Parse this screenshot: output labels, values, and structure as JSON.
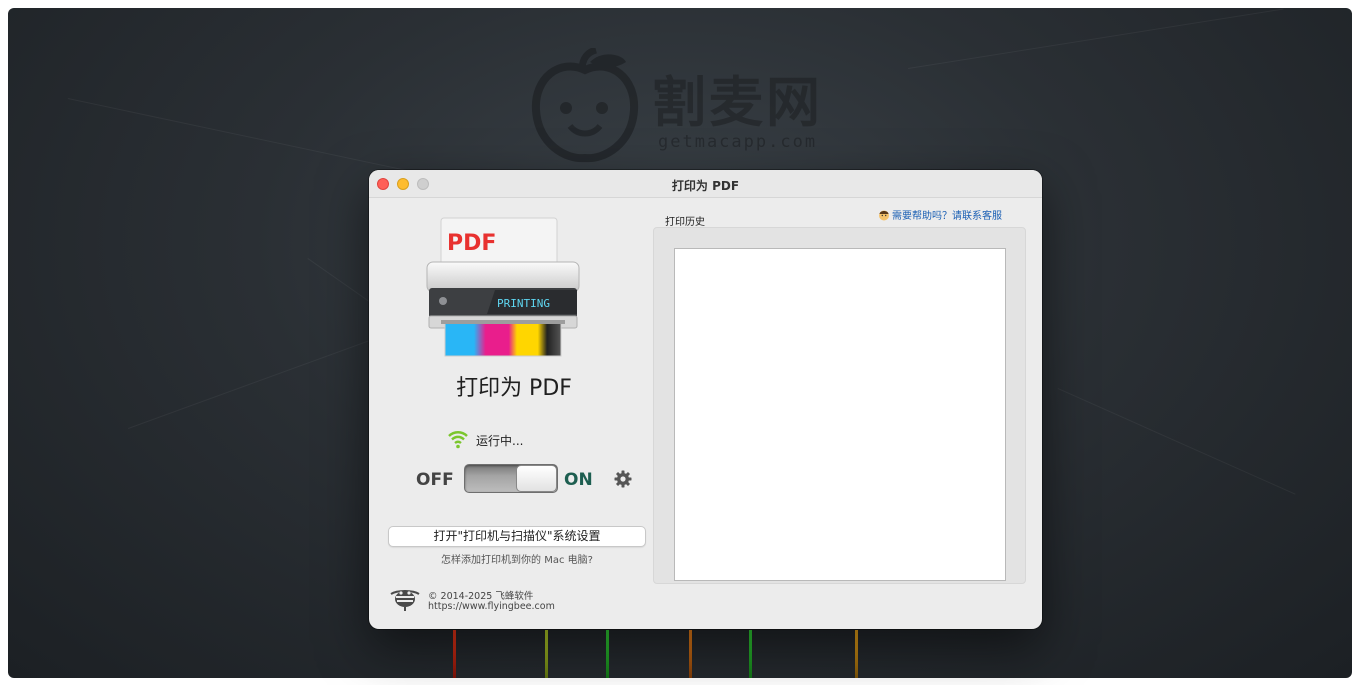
{
  "watermark": {
    "name": "割麦网",
    "url": "getmacapp.com"
  },
  "window": {
    "title": "打印为 PDF"
  },
  "app": {
    "name": "打印为 PDF",
    "printer_paper_text": "PDF",
    "printer_display_text": "PRINTING",
    "status": "运行中...",
    "switch": {
      "off_label": "OFF",
      "on_label": "ON",
      "state": "on"
    },
    "open_settings_button": "打开\"打印机与扫描仪\"系统设置",
    "add_printer_help": "怎样添加打印机到你的 Mac 电脑?",
    "copyright": "© 2014-2025 飞蜂软件",
    "website": "https://www.flyingbee.com"
  },
  "history": {
    "label": "打印历史",
    "help_link": "需要帮助吗？请联系客服",
    "items": []
  },
  "colors": {
    "accent_link": "#1a5fb4",
    "status_green": "#7bc62d",
    "on_label": "#1d5e50",
    "paper_red": "#e8312f"
  }
}
